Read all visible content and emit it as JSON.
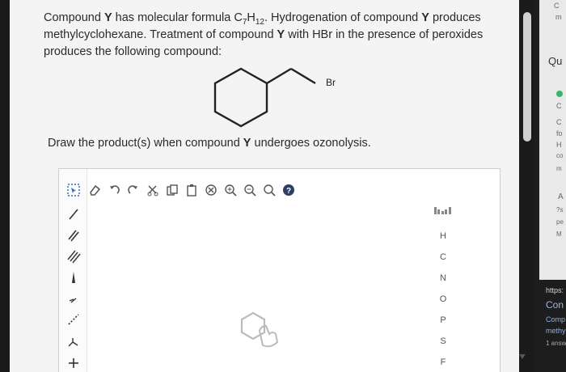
{
  "question": {
    "subject": "Compound",
    "compound_letter": "Y",
    "formula_text": "has molecular formula C",
    "formula_sub_c": "7",
    "formula_h": "H",
    "formula_sub_h": "12",
    "line1_rest": ". Hydrogenation of compound",
    "line1_y2": "Y",
    "line1_end": "produces",
    "line2_start": "methylcyclohexane. Treatment of compound",
    "line2_y": "Y",
    "line2_end": "with HBr in the presence of peroxides",
    "line3": "produces the following compound:"
  },
  "molecule": {
    "label": "Br"
  },
  "draw_prompt": {
    "text": "Draw the product(s) when compound",
    "letter": "Y",
    "end": "undergoes ozonolysis."
  },
  "elements": [
    "H",
    "C",
    "N",
    "O",
    "P",
    "S",
    "F"
  ],
  "right_panel": {
    "items": [
      "C",
      "m",
      "Qu",
      "C",
      "C",
      "fo",
      "H",
      "co",
      "m",
      "A",
      "?s",
      "pe",
      "M"
    ],
    "bottom": [
      "https:",
      "Con",
      "Comp",
      "methy",
      "1 answ"
    ]
  },
  "colors": {
    "accent": "#1e6fd0",
    "help": "#2c3e66"
  }
}
